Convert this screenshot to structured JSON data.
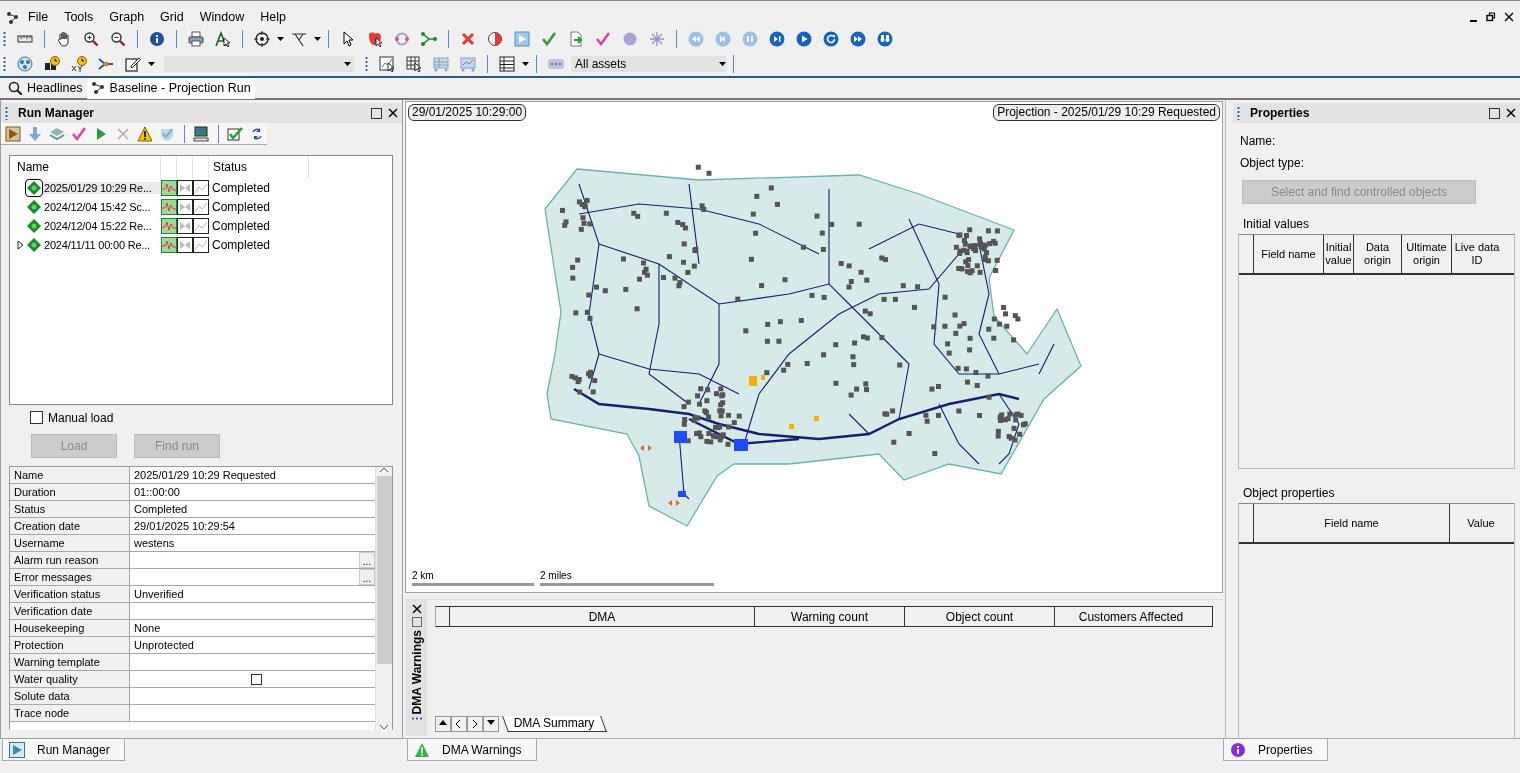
{
  "menu": [
    {
      "label": "File"
    },
    {
      "label": "Tools"
    },
    {
      "label": "Graph"
    },
    {
      "label": "Grid"
    },
    {
      "label": "Window"
    },
    {
      "label": "Help"
    }
  ],
  "asset_filter": {
    "value": "All assets"
  },
  "doc_tabs": [
    {
      "label": "Headlines",
      "selected": false
    },
    {
      "label": "Baseline - Projection Run",
      "selected": true
    }
  ],
  "run_manager": {
    "title": "Run Manager",
    "columns": [
      "Name",
      "Status"
    ],
    "rows": [
      {
        "name": "2025/01/29 10:29 Re...",
        "status": "Completed",
        "selected": true,
        "has_children": false
      },
      {
        "name": "2024/12/04 15:42 Sc...",
        "status": "Completed",
        "selected": false,
        "has_children": false
      },
      {
        "name": "2024/12/04 15:22 Re...",
        "status": "Completed",
        "selected": false,
        "has_children": false
      },
      {
        "name": "2024/11/11 00:00 Re...",
        "status": "Completed",
        "selected": false,
        "has_children": true
      }
    ],
    "manual_load": {
      "label": "Manual load",
      "checked": false
    },
    "buttons": [
      {
        "label": "Load",
        "disabled": true
      },
      {
        "label": "Find run",
        "disabled": true
      }
    ],
    "properties_grid": [
      {
        "field": "Name",
        "kind": "text",
        "value": "2025/01/29 10:29 Requested"
      },
      {
        "field": "Duration",
        "kind": "text",
        "value": "01::00:00"
      },
      {
        "field": "Status",
        "kind": "text",
        "value": "Completed"
      },
      {
        "field": "Creation date",
        "kind": "text",
        "value": "29/01/2025 10:29:54"
      },
      {
        "field": "Username",
        "kind": "text",
        "value": "westens"
      },
      {
        "field": "Alarm run reason",
        "kind": "ellipsis",
        "button": "..."
      },
      {
        "field": "Error messages",
        "kind": "ellipsis",
        "button": "..."
      },
      {
        "field": "Verification status",
        "kind": "text",
        "value": "Unverified"
      },
      {
        "field": "Verification date",
        "kind": "text"
      },
      {
        "field": "Housekeeping",
        "kind": "text",
        "value": "None"
      },
      {
        "field": "Protection",
        "kind": "text",
        "value": "Unprotected"
      },
      {
        "field": "Warning template",
        "kind": "text"
      },
      {
        "field": "Water quality",
        "kind": "checkbox",
        "checked": false
      },
      {
        "field": "Solute data",
        "kind": "text"
      },
      {
        "field": "Trace node",
        "kind": "text"
      }
    ]
  },
  "map": {
    "timestamp": "29/01/2025 10:29:00",
    "run_label": "Projection - 2025/01/29 10:29 Requested",
    "scales": [
      "2 km",
      "2 miles"
    ]
  },
  "dma_warnings": {
    "title": "DMA Warnings",
    "columns": [
      "DMA",
      "Warning count",
      "Object count",
      "Customers Affected"
    ],
    "sheet_tabs": [
      {
        "label": "DMA Summary",
        "selected": true
      }
    ]
  },
  "properties": {
    "title": "Properties",
    "fields": [
      "Name:",
      "Object type:"
    ],
    "button": {
      "label": "Select and find controlled objects",
      "disabled": true
    },
    "initial_values": {
      "title": "Initial values",
      "columns": [
        "Field name",
        "Initial value",
        "Data origin",
        "Ultimate origin",
        "Live data ID"
      ]
    },
    "object_properties": {
      "title": "Object properties",
      "columns": [
        "Field name",
        "Value"
      ]
    }
  },
  "bottom_tabs": [
    {
      "label": "Run Manager",
      "kind": "play"
    },
    {
      "label": "DMA Warnings",
      "kind": "warning"
    },
    {
      "label": "Properties",
      "kind": "info"
    }
  ]
}
